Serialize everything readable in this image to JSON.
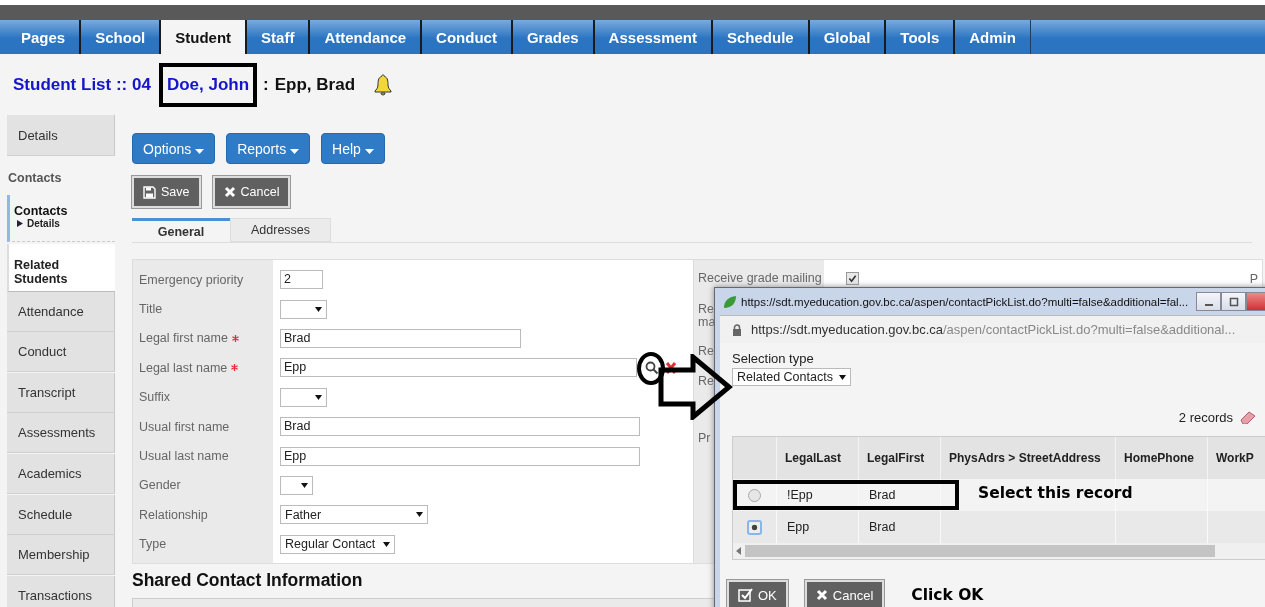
{
  "nav_tabs": [
    {
      "label": "Pages",
      "selected": false
    },
    {
      "label": "School",
      "selected": false
    },
    {
      "label": "Student",
      "selected": true
    },
    {
      "label": "Staff",
      "selected": false
    },
    {
      "label": "Attendance",
      "selected": false
    },
    {
      "label": "Conduct",
      "selected": false
    },
    {
      "label": "Grades",
      "selected": false
    },
    {
      "label": "Assessment",
      "selected": false
    },
    {
      "label": "Schedule",
      "selected": false
    },
    {
      "label": "Global",
      "selected": false
    },
    {
      "label": "Tools",
      "selected": false
    },
    {
      "label": "Admin",
      "selected": false
    }
  ],
  "breadcrumb": {
    "list_link": "Student List :: 04",
    "student_link": "Doe, John",
    "separator": ":",
    "current": "Epp, Brad"
  },
  "sidebar": [
    {
      "kind": "tab",
      "label": "Details",
      "selected": false
    },
    {
      "kind": "heading",
      "label": "Contacts"
    },
    {
      "kind": "current",
      "label": "Contacts",
      "sub": "Details",
      "selected": true
    },
    {
      "kind": "open",
      "label": "Related Students",
      "selected": false
    },
    {
      "kind": "tab",
      "label": "Attendance",
      "selected": false
    },
    {
      "kind": "tab",
      "label": "Conduct",
      "selected": false
    },
    {
      "kind": "tab",
      "label": "Transcript",
      "selected": false
    },
    {
      "kind": "tab",
      "label": "Assessments",
      "selected": false
    },
    {
      "kind": "tab",
      "label": "Academics",
      "selected": false
    },
    {
      "kind": "tab",
      "label": "Schedule",
      "selected": false
    },
    {
      "kind": "tab",
      "label": "Membership",
      "selected": false
    },
    {
      "kind": "tab",
      "label": "Transactions",
      "selected": false
    }
  ],
  "menu_buttons": [
    "Options",
    "Reports",
    "Help"
  ],
  "action_buttons": [
    {
      "kind": "save",
      "label": "Save"
    },
    {
      "kind": "cancel",
      "label": "Cancel"
    }
  ],
  "form_tabs": [
    {
      "label": "General",
      "selected": true
    },
    {
      "label": "Addresses",
      "selected": false
    }
  ],
  "fields": [
    {
      "label": "Emergency priority",
      "required": false,
      "kind": "input",
      "value": "2"
    },
    {
      "label": "Title",
      "required": false,
      "kind": "select"
    },
    {
      "label": "Legal first name",
      "required": true,
      "kind": "input",
      "value": "Brad"
    },
    {
      "label": "Legal last name",
      "required": true,
      "kind": "lookup",
      "value": "Epp"
    },
    {
      "label": "Suffix",
      "required": false,
      "kind": "select"
    },
    {
      "label": "Usual first name",
      "required": false,
      "kind": "input",
      "value": "Brad"
    },
    {
      "label": "Usual last name",
      "required": false,
      "kind": "input",
      "value": "Epp"
    },
    {
      "label": "Gender",
      "required": false,
      "kind": "select"
    },
    {
      "label": "Relationship",
      "required": false,
      "kind": "select",
      "value": "Father"
    },
    {
      "label": "Type",
      "required": false,
      "kind": "select",
      "value": "Regular Contact"
    }
  ],
  "right_fields": [
    {
      "label": "Receive grade mailing",
      "kind": "checkbox",
      "checked": true
    },
    {
      "label": "Re ma",
      "kind": "text"
    },
    {
      "label": "Re",
      "kind": "text"
    },
    {
      "label": "Re",
      "kind": "text"
    },
    {
      "label": "Pr",
      "kind": "text"
    }
  ],
  "far_right_label": "P",
  "section_title": "Shared Contact Information",
  "popup": {
    "title": "https://sdt.myeducation.gov.bc.ca/aspen/contactPickList.do?multi=false&additional=fal...",
    "url_host": "https://sdt.myeducation.gov.bc.ca",
    "url_path": "/aspen/contactPickList.do?multi=false&additional...",
    "selection_label": "Selection type",
    "selection_value": "Related Contacts",
    "record_count": "2 records",
    "columns": [
      "LegalLast",
      "LegalFirst",
      "PhysAdrs > StreetAddress",
      "HomePhone",
      "WorkP"
    ],
    "rows": [
      {
        "selected": false,
        "cells": [
          "!Epp",
          "Brad"
        ]
      },
      {
        "selected": true,
        "cells": [
          "Epp",
          "Brad"
        ]
      }
    ],
    "buttons": [
      {
        "kind": "ok",
        "label": "OK"
      },
      {
        "kind": "cancel",
        "label": "Cancel"
      }
    ]
  },
  "annotations": {
    "select_note": "Select this record",
    "ok_note": "Click OK"
  }
}
